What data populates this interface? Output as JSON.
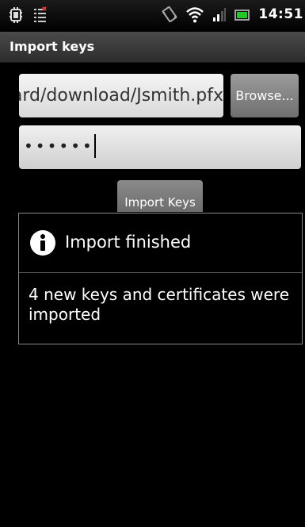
{
  "status_bar": {
    "time": "14:51",
    "icons": [
      "usb-debug-icon",
      "notification-icon",
      "vibrate-icon",
      "wifi-icon",
      "signal-icon",
      "battery-icon"
    ]
  },
  "title_bar": {
    "title": "Import keys"
  },
  "form": {
    "path_value": "/mnt/sdcard/download/Jsmith.pfx",
    "browse_label": "Browse...",
    "password_mask": "••••••",
    "import_label": "Import Keys"
  },
  "dialog": {
    "icon": "info-icon",
    "title": "Import finished",
    "message": "4 new keys and certificates were imported"
  },
  "colors": {
    "background": "#000000",
    "titlebar": "#3a3a3a",
    "wifi": "#ffffff",
    "battery": "#22c82a"
  }
}
